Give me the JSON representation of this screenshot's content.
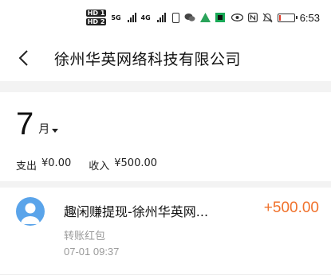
{
  "status_bar": {
    "sim1": "HD 1",
    "sim2": "HD 2",
    "net1": "5G",
    "net2": "4G",
    "icons": [
      "signal-icon",
      "signal-icon",
      "sim-card-icon",
      "wechat-icon",
      "app-icon",
      "app-icon",
      "eye-icon",
      "nfc-icon",
      "mute-icon",
      "battery-icon"
    ],
    "battery_level": 0.08,
    "time": "6:53"
  },
  "header": {
    "title": "徐州华英网络科技有限公司"
  },
  "summary": {
    "month": "7",
    "month_unit": "月",
    "expense_label": "支出",
    "expense_value": "¥0.00",
    "income_label": "收入",
    "income_value": "¥500.00"
  },
  "transactions": [
    {
      "title": "趣闲赚提现-徐州华英网...",
      "amount": "+500.00",
      "type": "转账红包",
      "time": "07-01  09:37"
    }
  ],
  "colors": {
    "amount": "#f0712b",
    "avatar": "#5aa4ea",
    "divider": "#f3f3f3"
  }
}
